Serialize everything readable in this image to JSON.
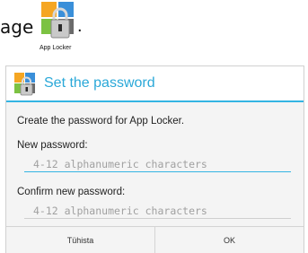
{
  "top_fragment": {
    "text": "age",
    "punctuation": ".",
    "icon_name": "app-locker-icon",
    "icon_caption": "App Locker"
  },
  "dialog": {
    "title": "Set the password",
    "icon_name": "app-locker-icon",
    "accent_color": "#34b4e3",
    "description": "Create the password for App Locker.",
    "new_password": {
      "label": "New password:",
      "placeholder": "4-12 alphanumeric characters",
      "value": ""
    },
    "confirm_password": {
      "label": "Confirm new password:",
      "placeholder": "4-12 alphanumeric characters",
      "value": ""
    },
    "buttons": {
      "cancel": "Tühista",
      "ok": "OK"
    }
  }
}
